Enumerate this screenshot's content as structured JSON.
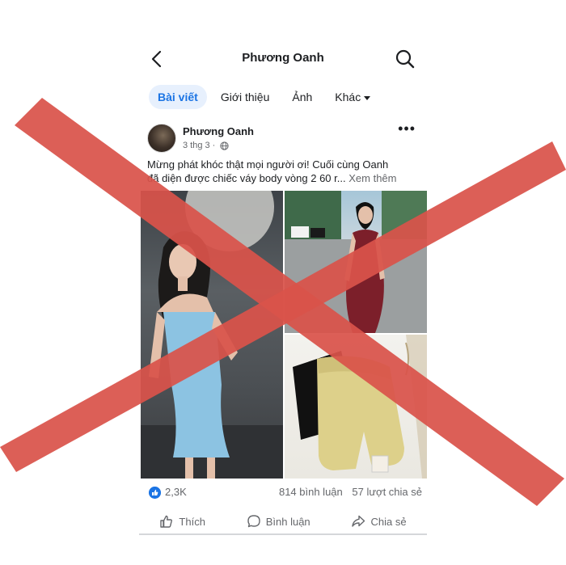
{
  "header": {
    "title": "Phương Oanh"
  },
  "tabs": [
    {
      "label": "Bài viết",
      "active": true
    },
    {
      "label": "Giới thiệu",
      "active": false
    },
    {
      "label": "Ảnh",
      "active": false
    },
    {
      "label": "Khác",
      "active": false
    }
  ],
  "post": {
    "author": "Phương Oanh",
    "date": "3 thg 3",
    "separator": "·",
    "text_line1": "Mừng phát khóc thật mọi người ơi! Cuối cùng Oanh",
    "text_line2": "đã diện được chiếc váy body vòng 2 60 r...",
    "see_more": "Xem thêm",
    "likes": "2,3K",
    "comments": "814 bình luận",
    "shares": "57 lượt chia sẻ"
  },
  "actions": {
    "like": "Thích",
    "comment": "Bình luận",
    "share": "Chia sẻ"
  },
  "colors": {
    "accent": "#1b74e4",
    "overlay_x": "#d9534a"
  }
}
